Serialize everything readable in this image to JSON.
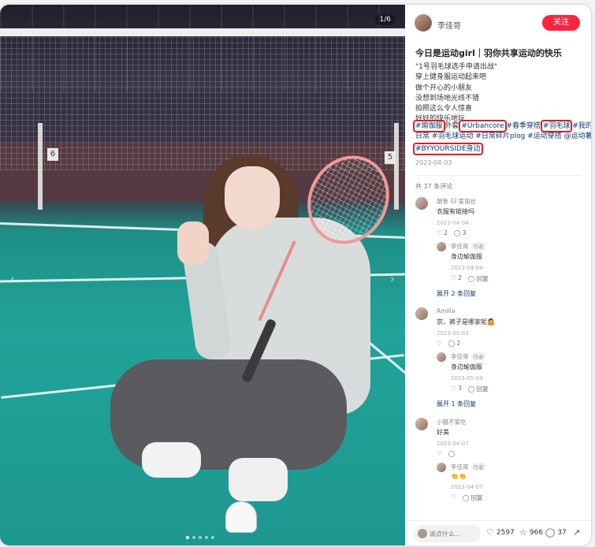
{
  "photo": {
    "counter": "1/6",
    "prev_icon": "chevron-left-icon",
    "next_icon": "chevron-right-icon",
    "court_signs": [
      "6",
      "5"
    ],
    "dots": 5,
    "active_dot": 0
  },
  "author": {
    "name": "李佳哥",
    "follow_label": "关注"
  },
  "post": {
    "title": "今日是运动girl｜羽你共享运动的快乐",
    "lines": [
      "\"1号羽毛球选手申请出战\"",
      "穿上健身服运动起来吧",
      "做个开心的小朋友",
      "没想到场地光线不错",
      "拍照这么令人惊喜",
      "好好的快乐地玩"
    ],
    "tags_row1": [
      "#瑜伽服",
      "外套",
      "#Urbancore",
      "#春季穿搭",
      "#羽毛球",
      "#我的"
    ],
    "tags_row2": [
      "日常",
      "#羽毛球运动",
      "#日常碎片plog",
      "#运动穿搭",
      "@运动薯"
    ],
    "tags_row3": [
      "#BYYOURSIDE身边"
    ],
    "date": "2023-04-03",
    "count": "共 37 条评论"
  },
  "comments": [
    {
      "user": "朝鲁 🐱 爱丽丝",
      "text": "衣服有链接吗",
      "date": "2023-04-04",
      "likes": "2",
      "replies": "3",
      "reply": {
        "user": "李佳哥",
        "badge": "作者",
        "text": "身边瑜伽服",
        "date": "2023-04-04",
        "likes": "2",
        "action": "回复"
      },
      "expand": "展开 2 条回复"
    },
    {
      "user": "Amilla",
      "text": "宗，裤子是哪家呢🤷",
      "date": "2023-05-03",
      "likes": "",
      "replies": "2",
      "reply": {
        "user": "李佳哥",
        "badge": "作者",
        "text": "身边瑜伽服",
        "date": "2023-05-04",
        "likes": "3",
        "action": "回复"
      },
      "expand": "展开 1 条回复"
    },
    {
      "user": "小猫不爱吃",
      "text": "好美",
      "date": "2023-04-07",
      "likes": "",
      "replies": "",
      "reply": {
        "user": "李佳哥",
        "badge": "作者",
        "text": "👏👏",
        "date": "2023-04-07",
        "likes": "",
        "action": "回复"
      },
      "expand": ""
    }
  ],
  "bottom": {
    "placeholder": "说点什么...",
    "likes": "2597",
    "stars": "966",
    "comments": "37"
  },
  "colors": {
    "accent": "#ff2442",
    "tag": "#13386c",
    "highlight": "#e01f1f"
  }
}
